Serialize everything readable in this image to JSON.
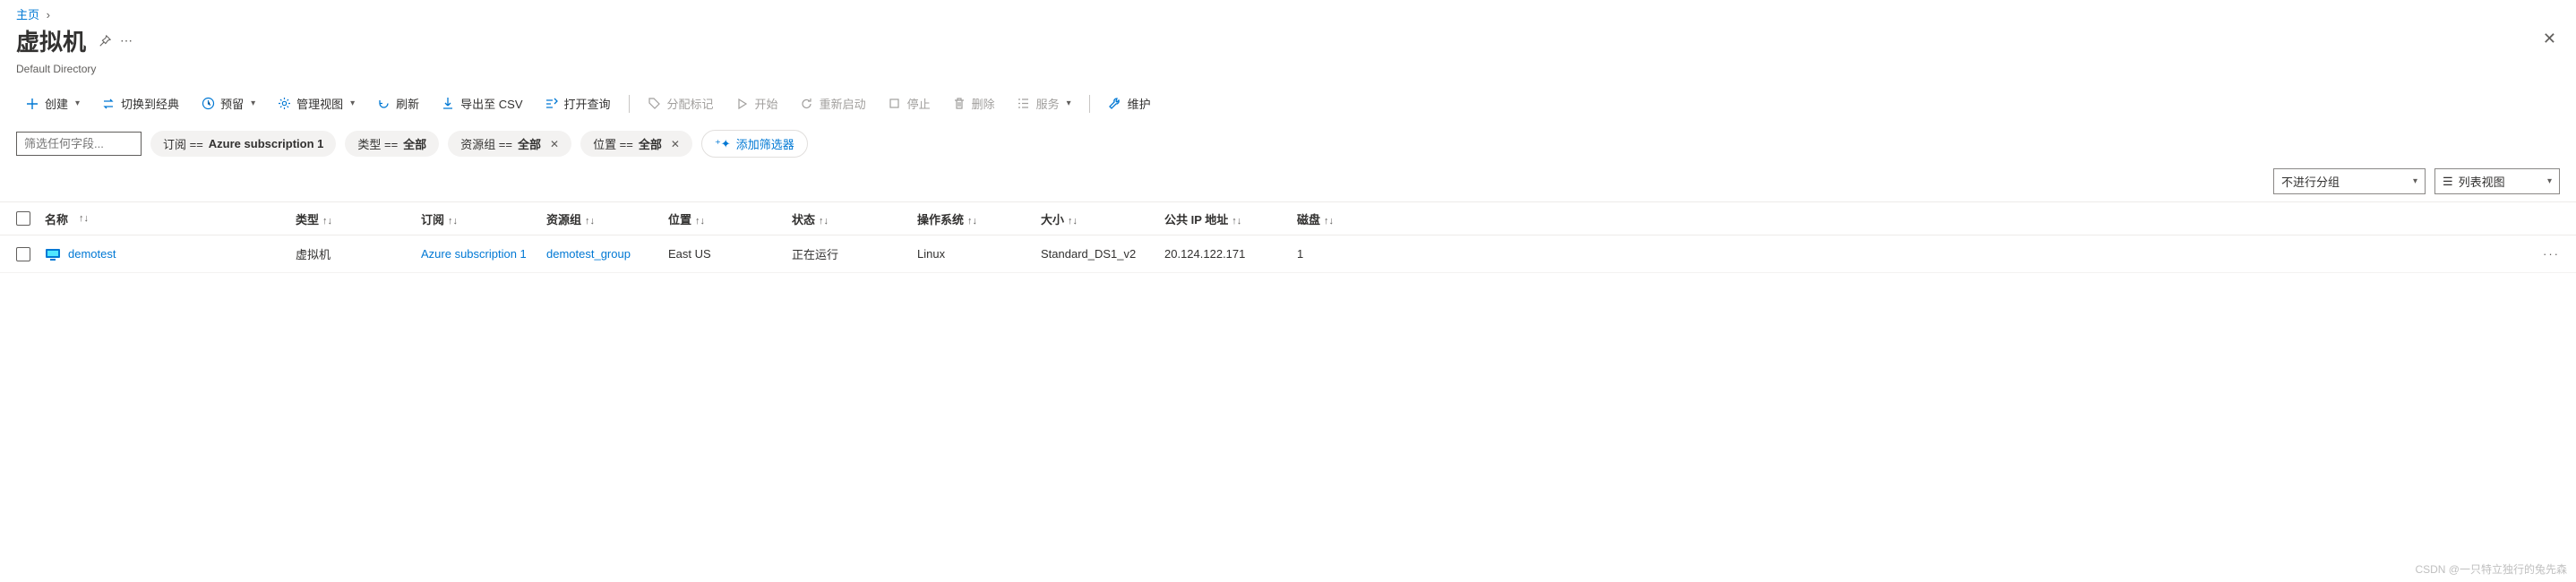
{
  "breadcrumb": {
    "home": "主页"
  },
  "header": {
    "title": "虚拟机",
    "subtitle": "Default Directory"
  },
  "toolbar": {
    "create": "创建",
    "toClassic": "切换到经典",
    "reserve": "预留",
    "manageView": "管理视图",
    "refresh": "刷新",
    "exportCsv": "导出至 CSV",
    "openQuery": "打开查询",
    "assignTag": "分配标记",
    "start": "开始",
    "restart": "重新启动",
    "stop": "停止",
    "delete": "删除",
    "services": "服务",
    "maintain": "维护"
  },
  "filters": {
    "placeholder": "筛选任何字段...",
    "sub_label": "订阅 == ",
    "sub_value": "Azure subscription 1",
    "type_label": "类型 == ",
    "type_value": "全部",
    "rg_label": "资源组 == ",
    "rg_value": "全部",
    "loc_label": "位置 == ",
    "loc_value": "全部",
    "add": "添加筛选器"
  },
  "controls": {
    "group": "不进行分组",
    "view": "列表视图"
  },
  "columns": {
    "name": "名称",
    "type": "类型",
    "sub": "订阅",
    "rg": "资源组",
    "loc": "位置",
    "status": "状态",
    "os": "操作系统",
    "size": "大小",
    "ip": "公共 IP 地址",
    "disk": "磁盘"
  },
  "rows": [
    {
      "name": "demotest",
      "type": "虚拟机",
      "sub": "Azure subscription 1",
      "rg": "demotest_group",
      "loc": "East US",
      "status": "正在运行",
      "os": "Linux",
      "size": "Standard_DS1_v2",
      "ip": "20.124.122.171",
      "disk": "1"
    }
  ],
  "watermark": "CSDN @一只特立独行的兔先森"
}
